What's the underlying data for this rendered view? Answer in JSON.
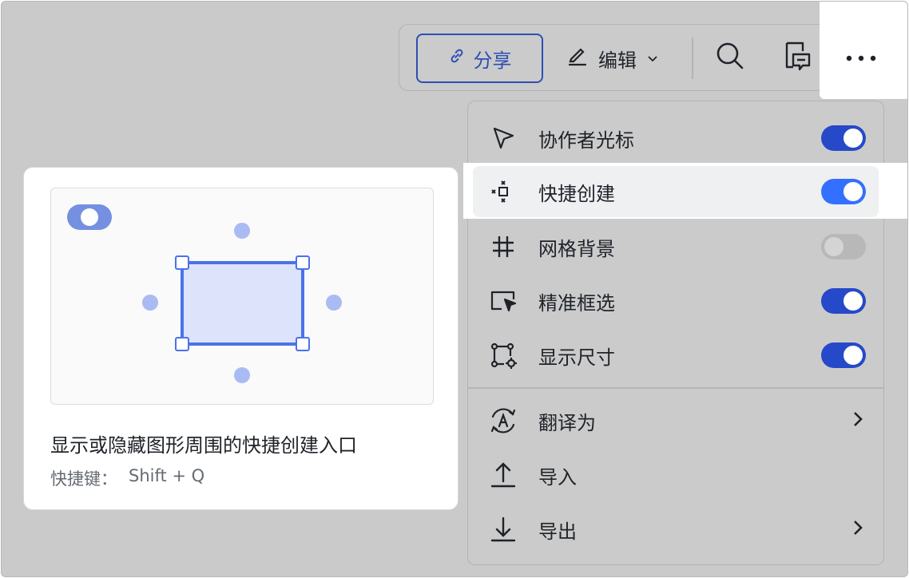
{
  "toolbar": {
    "share_label": "分享",
    "edit_label": "编辑",
    "icons": [
      "link-icon",
      "pencil-icon",
      "chevron-down-icon",
      "search-icon",
      "comment-icon",
      "more-icon"
    ]
  },
  "menu": {
    "items": [
      {
        "label": "协作者光标",
        "icon": "cursor-arrow-icon",
        "toggle": "on"
      },
      {
        "label": "快捷创建",
        "icon": "quick-create-icon",
        "toggle": "on"
      },
      {
        "label": "网格背景",
        "icon": "grid-icon",
        "toggle": "off"
      },
      {
        "label": "精准框选",
        "icon": "box-select-icon",
        "toggle": "on"
      },
      {
        "label": "显示尺寸",
        "icon": "dimension-icon",
        "toggle": "on"
      },
      {
        "label": "翻译为",
        "icon": "translate-icon",
        "has_submenu": true
      },
      {
        "label": "导入",
        "icon": "upload-icon"
      },
      {
        "label": "导出",
        "icon": "download-icon",
        "has_submenu": true
      }
    ]
  },
  "tooltip": {
    "title": "显示或隐藏图形周围的快捷创建入口",
    "shortcut_label": "快捷键：",
    "shortcut_keys": "Shift + Q"
  },
  "colors": {
    "accent": "#2d4fb3",
    "toggle_on": "#2549c8",
    "toggle_on_active": "#3370ff",
    "preview_shape_fill": "#dde3fb",
    "preview_shape_stroke": "#4a73e8",
    "preview_dot": "#a9bbf2"
  }
}
